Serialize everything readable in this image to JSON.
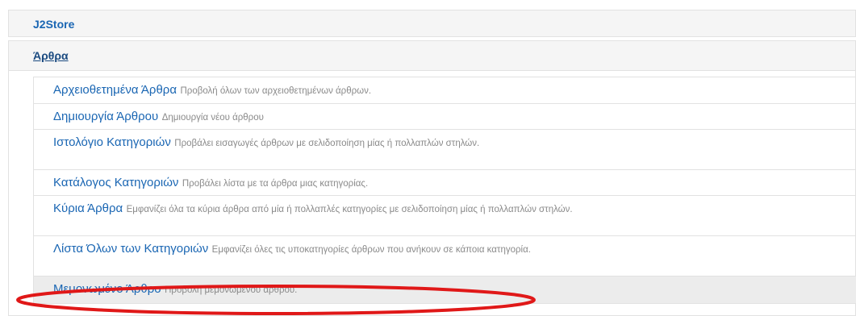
{
  "sections": {
    "j2store": {
      "label": "J2Store"
    },
    "arthra": {
      "label": "Άρθρα"
    }
  },
  "menu_items": [
    {
      "title": "Αρχειοθετημένα Άρθρα",
      "description": "Προβολή όλων των αρχειοθετημένων άρθρων."
    },
    {
      "title": "Δημιουργία Άρθρου",
      "description": "Δημιουργία νέου άρθρου"
    },
    {
      "title": "Ιστολόγιο Κατηγοριών",
      "description": "Προβάλει εισαγωγές άρθρων με σελιδοποίηση μίας ή πολλαπλών στηλών."
    },
    {
      "title": "Κατάλογος Κατηγοριών",
      "description": "Προβάλει λίστα με τα άρθρα μιας κατηγορίας."
    },
    {
      "title": "Κύρια Άρθρα",
      "description": "Εμφανίζει όλα τα κύρια άρθρα από μία ή πολλαπλές κατηγορίες με σελιδοποίηση μίας ή πολλαπλών στηλών."
    },
    {
      "title": "Λίστα Όλων των Κατηγοριών",
      "description": "Εμφανίζει όλες τις υποκατηγορίες άρθρων που ανήκουν σε κάποια κατηγορία."
    },
    {
      "title": "Μεμονωμένο Άρθρο",
      "description": "Προβολή μεμονωμένου άρθρου."
    }
  ],
  "highlight": {
    "color": "#e01818",
    "target_item_index": 6
  },
  "colors": {
    "link_blue": "#1a66b3",
    "desc_gray": "#8a8a8a",
    "section_bg": "#f5f5f5",
    "selected_bg": "#ececec"
  }
}
